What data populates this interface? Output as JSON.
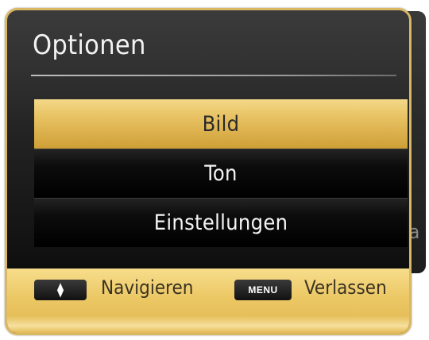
{
  "background": {
    "fragment_text": "ta"
  },
  "dialog": {
    "title": "Optionen",
    "items": [
      {
        "label": "Bild",
        "selected": true
      },
      {
        "label": "Ton",
        "selected": false
      },
      {
        "label": "Einstellungen",
        "selected": false
      }
    ]
  },
  "footer": {
    "navigate_icon": "up-down-arrows-icon",
    "navigate_label": "Navigieren",
    "menu_key_label": "MENU",
    "exit_label": "Verlassen"
  },
  "colors": {
    "accent_gold": "#e8c263",
    "panel_dark": "#121212",
    "text_light": "#f4f4f4"
  }
}
